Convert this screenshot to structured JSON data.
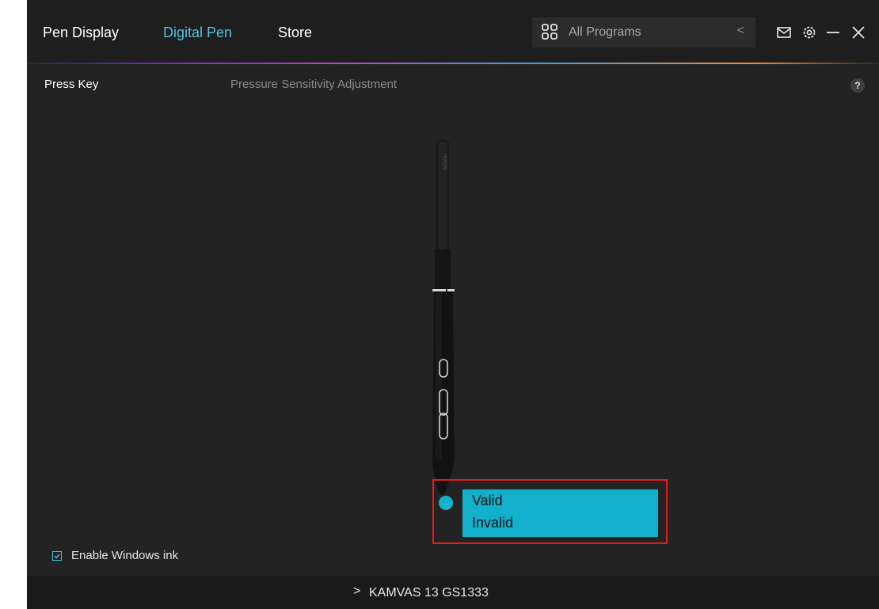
{
  "nav": {
    "tabs": [
      {
        "label": "Pen Display",
        "active": false
      },
      {
        "label": "Digital Pen",
        "active": true
      },
      {
        "label": "Store",
        "active": false
      }
    ]
  },
  "program_selector": {
    "icon": "apps-grid-icon",
    "label": "All Programs",
    "chevron": "<"
  },
  "window_controls": {
    "icons": [
      "mail-icon",
      "gear-icon",
      "minimize-icon",
      "close-icon"
    ]
  },
  "subtabs": [
    {
      "label": "Press Key",
      "active": true
    },
    {
      "label": "Pressure Sensitivity Adjustment",
      "active": false
    }
  ],
  "help": {
    "label": "?"
  },
  "pen": {
    "brand_text": "HUION",
    "buttons": [
      "upper-side-button",
      "middle-side-button",
      "lower-side-button"
    ]
  },
  "tip_menu": {
    "options": [
      "Valid",
      "Invalid"
    ]
  },
  "windows_ink": {
    "label": "Enable Windows ink",
    "checked": true
  },
  "device": {
    "chevron": ">",
    "name": "KAMVAS 13 GS1333"
  },
  "colors": {
    "accent": "#4fc3e0",
    "tip_menu": "#12b0cd",
    "highlight_border": "#e31b1b",
    "background": "#232323"
  }
}
